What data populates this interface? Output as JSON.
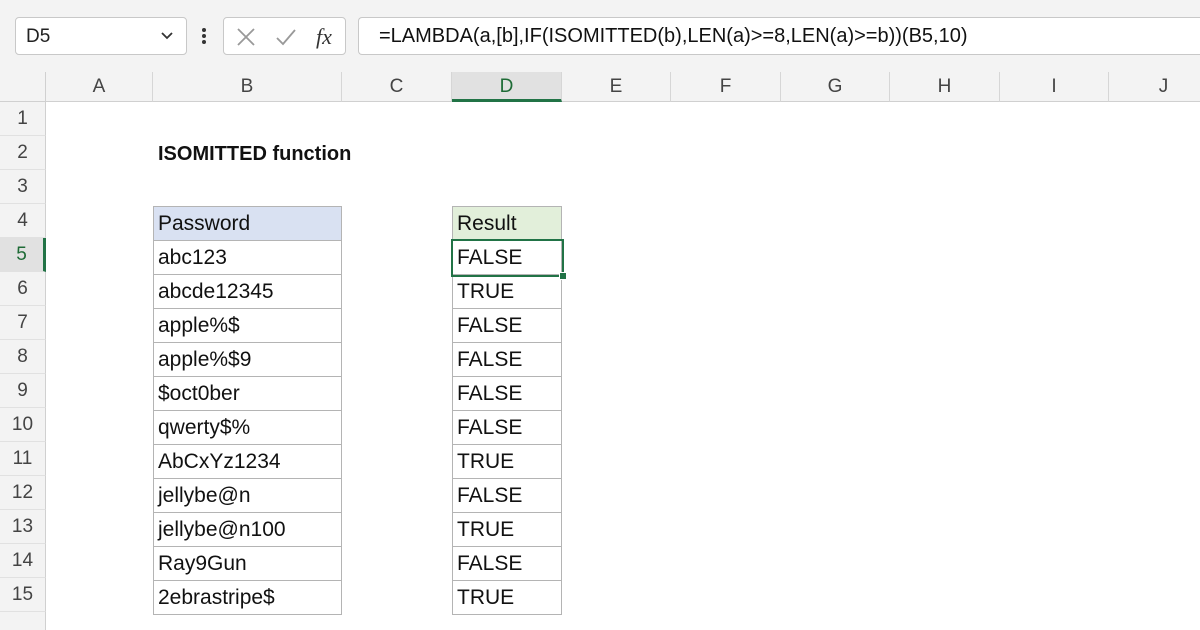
{
  "name_box": {
    "value": "D5"
  },
  "formula_bar": {
    "cancel_icon": "x-icon",
    "enter_icon": "check-icon",
    "function_icon": "fx-icon",
    "formula": "=LAMBDA(a,[b],IF(ISOMITTED(b),LEN(a)>=8,LEN(a)>=b))(B5,10)"
  },
  "columns": [
    "A",
    "B",
    "C",
    "D",
    "E",
    "F",
    "G",
    "H",
    "I",
    "J"
  ],
  "active_column": "D",
  "rows": [
    "1",
    "2",
    "3",
    "4",
    "5",
    "6",
    "7",
    "8",
    "9",
    "10",
    "11",
    "12",
    "13",
    "14",
    "15"
  ],
  "active_row": "5",
  "sheet": {
    "title": "ISOMITTED function",
    "password_header": "Password",
    "result_header": "Result",
    "passwords": [
      "abc123",
      "abcde12345",
      "apple%$",
      "apple%$9",
      "$oct0ber",
      "qwerty$%",
      "AbCxYz1234",
      "jellybe@n",
      "jellybe@n100",
      "Ray9Gun",
      "2ebrastripe$"
    ],
    "results": [
      "FALSE",
      "TRUE",
      "FALSE",
      "FALSE",
      "FALSE",
      "FALSE",
      "TRUE",
      "FALSE",
      "TRUE",
      "FALSE",
      "TRUE"
    ]
  },
  "colors": {
    "accent": "#217346",
    "header_blue": "#d9e1f2",
    "header_green": "#e2efda"
  }
}
